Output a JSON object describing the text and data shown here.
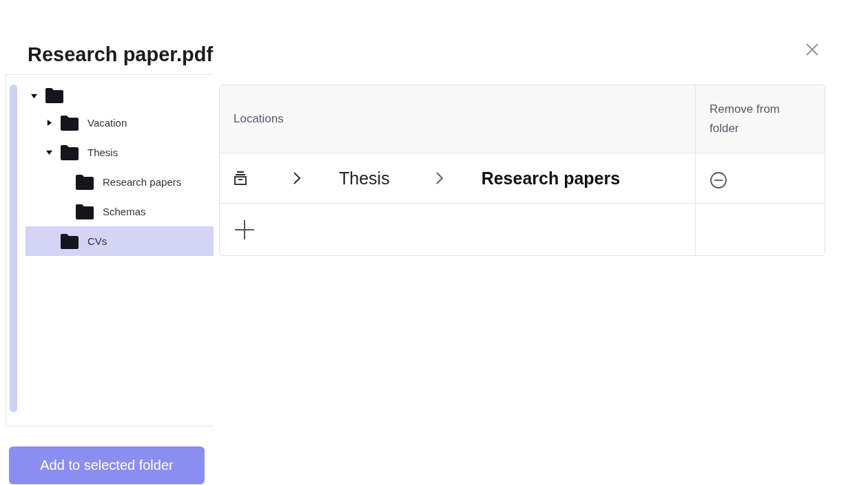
{
  "dialog": {
    "title": "Research paper.pdf"
  },
  "tree": [
    {
      "expanded": true,
      "selected": false,
      "children": [
        {
          "label": "Vacation",
          "expanded": false,
          "selected": false
        },
        {
          "label": "Thesis",
          "expanded": true,
          "selected": false,
          "children": [
            {
              "label": "Research papers",
              "selected": false
            },
            {
              "label": "Schemas",
              "selected": false
            }
          ]
        },
        {
          "label": "CVs",
          "selected": true
        }
      ]
    }
  ],
  "table": {
    "columns": [
      "Locations",
      "Remove from folder"
    ],
    "rows": [
      {
        "segments": [
          "Thesis",
          "Research papers"
        ]
      }
    ]
  },
  "add_button": "Add to selected folder"
}
